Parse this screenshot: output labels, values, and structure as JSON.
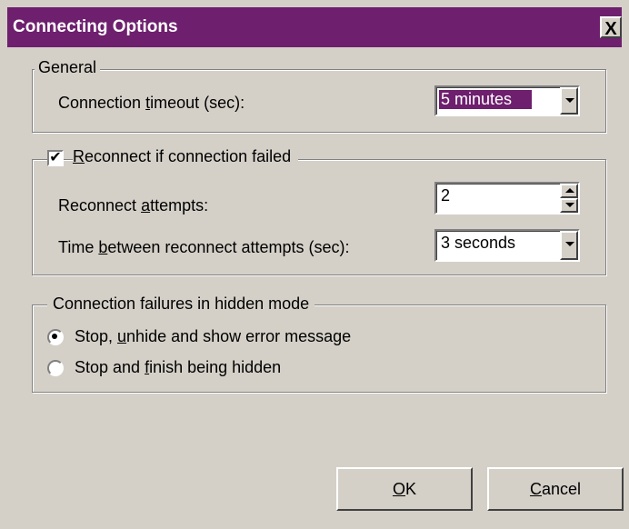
{
  "window": {
    "title": "Connecting Options",
    "close_glyph": "X"
  },
  "general": {
    "legend": "General",
    "timeout_label_pre": "Connection ",
    "timeout_label_mnemonic": "t",
    "timeout_label_post": "imeout (sec):",
    "timeout_value": "5 minutes"
  },
  "reconnect": {
    "checkbox_checked": true,
    "check_glyph": "✔",
    "legend_mnemonic": "R",
    "legend_post": "econnect if connection failed",
    "attempts_label_pre": "Reconnect ",
    "attempts_label_mnemonic": "a",
    "attempts_label_post": "ttempts:",
    "attempts_value": "2",
    "between_label_pre": "Time ",
    "between_label_mnemonic": "b",
    "between_label_post": "etween reconnect attempts (sec):",
    "between_value": "3 seconds"
  },
  "hidden_mode": {
    "legend": "Connection failures in hidden mode",
    "option1_pre": "Stop, ",
    "option1_mnemonic": "u",
    "option1_post": "nhide and show error message",
    "option2_pre": "Stop and ",
    "option2_mnemonic": "f",
    "option2_post": "inish being hidden",
    "selected_option": 1
  },
  "buttons": {
    "ok_mnemonic": "O",
    "ok_post": "K",
    "cancel_mnemonic": "C",
    "cancel_post": "ancel"
  },
  "colors": {
    "titlebar": "#6e1f6e",
    "face": "#d4d0c8",
    "selection": "#6e1f6e"
  }
}
